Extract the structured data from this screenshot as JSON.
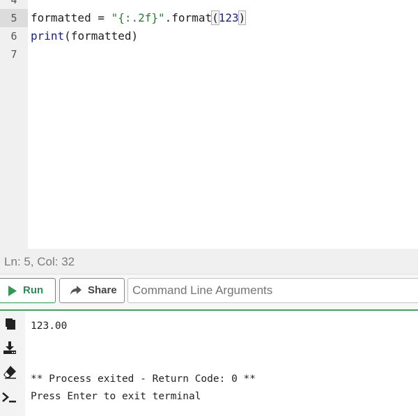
{
  "editor": {
    "lines": [
      {
        "number": "4",
        "tokens": []
      },
      {
        "number": "5",
        "tokens": [
          {
            "text": "formatted = ",
            "kind": "plain"
          },
          {
            "text": "\"{:.2f}\"",
            "kind": "str"
          },
          {
            "text": ".format",
            "kind": "plain"
          },
          {
            "text": "(",
            "kind": "paren"
          },
          {
            "text": "123",
            "kind": "num"
          },
          {
            "text": ")",
            "kind": "paren"
          }
        ]
      },
      {
        "number": "6",
        "tokens": [
          {
            "text": "print",
            "kind": "fn"
          },
          {
            "text": "(formatted)",
            "kind": "plain"
          }
        ]
      },
      {
        "number": "7",
        "tokens": []
      }
    ]
  },
  "status": {
    "text": "Ln: 5,  Col: 32"
  },
  "toolbar": {
    "run_label": "Run",
    "share_label": "Share",
    "args_placeholder": "Command Line Arguments"
  },
  "terminal": {
    "tools": [
      "copy-icon",
      "download-icon",
      "eraser-icon",
      "terminal-prompt-icon"
    ],
    "result": "123.00",
    "exit_message": "** Process exited - Return Code: 0 **",
    "enter_message": "Press Enter to exit terminal"
  },
  "colors": {
    "accent_green": "#3aa657",
    "gutter": "#f0f0f0",
    "active_gutter": "#dcdcdc",
    "string": "#2e7d32",
    "builtin": "#1a237e"
  }
}
